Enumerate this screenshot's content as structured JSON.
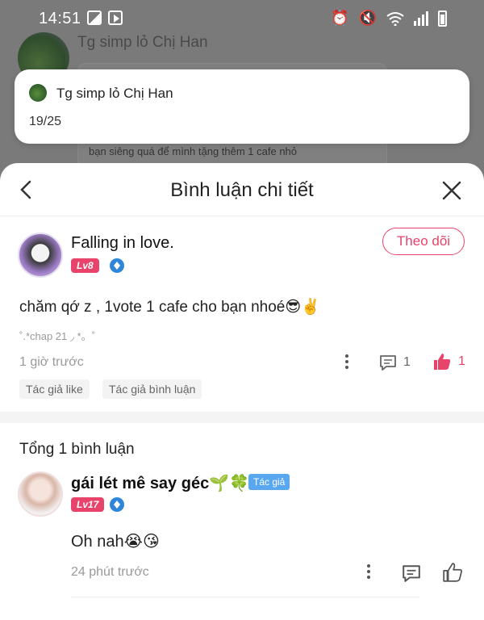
{
  "status_bar": {
    "time": "14:51"
  },
  "background": {
    "title": "Tg simp lỏ Chị Han",
    "comment_snippet": "bạn siêng quá để mình tặng thêm 1 cafe nhỏ"
  },
  "notification": {
    "title": "Tg simp lỏ Chị Han",
    "text": "19/25"
  },
  "sheet": {
    "title": "Bình luận chi tiết",
    "main_comment": {
      "user_name": "Falling in love.",
      "level": "Lv8",
      "follow_label": "Theo dõi",
      "text": "chăm qớ z , 1vote 1 cafe cho bạn nhoé😎✌️",
      "chapter": "˚.*chap 21 ◞ *。˚",
      "time": "1 giờ trước",
      "reply_count": "1",
      "like_count": "1",
      "chips": [
        "Tác giả like",
        "Tác giả bình luận"
      ]
    },
    "total_label": "Tổng 1 bình luận",
    "reply": {
      "user_name": "gái lét mê say géc🌱🍀",
      "author_badge": "Tác giả",
      "level": "Lv17",
      "text": "Oh nah😭😘",
      "time": "24 phút trước"
    }
  },
  "colors": {
    "accent": "#e8436b",
    "author_badge": "#59a8ef",
    "level_badge": "#e8436b",
    "shield": "#2f86d8"
  },
  "icons": [
    "back-arrow-icon",
    "close-icon",
    "more-vertical-icon",
    "comment-icon",
    "thumbs-up-icon",
    "shield-icon"
  ]
}
